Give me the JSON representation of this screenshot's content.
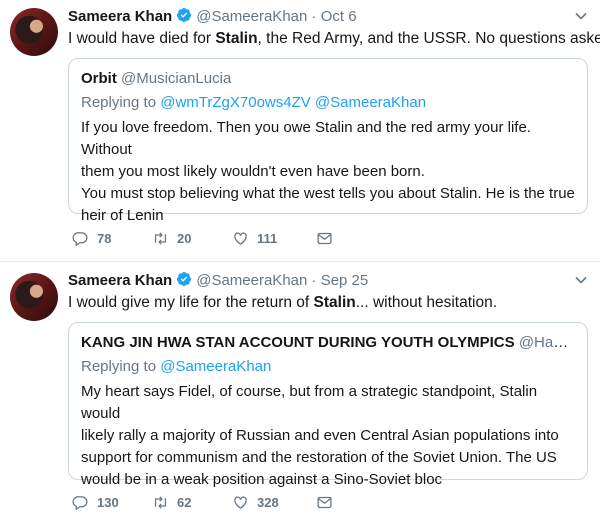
{
  "tweets": [
    {
      "author_name": "Sameera Khan",
      "author_handle": "@SameeraKhan",
      "separator": "·",
      "date": "Oct 6",
      "text_parts": [
        "I would have died for ",
        "Stalin",
        ", the Red Army, and the USSR. No questions asked."
      ],
      "quote": {
        "name": "Orbit",
        "handle": "@MusicianLucia",
        "replying_label": "Replying to",
        "replying_to": "@wmTrZgX70ows4ZV @SameeraKhan",
        "lines": [
          "If you love freedom. Then you owe Stalin and the red army your life. Without",
          "them you most likely wouldn't even have been born.",
          "You must stop believing what the west tells you about Stalin. He is the true",
          "heir of Lenin"
        ]
      },
      "replies": "78",
      "retweets": "20",
      "likes": "111"
    },
    {
      "author_name": "Sameera Khan",
      "author_handle": "@SameeraKhan",
      "separator": "·",
      "date": "Sep 25",
      "text_parts": [
        "I would give my life for the return of ",
        "Stalin",
        "... without hesitation."
      ],
      "quote": {
        "name": "KANG JIN HWA STAN ACCOUNT DURING YOUTH OLYMPICS",
        "handle": "@Hamsi...",
        "replying_label": "Replying to",
        "replying_to": "@SameeraKhan",
        "lines": [
          "My heart says Fidel, of course, but from a strategic standpoint, Stalin would",
          "likely rally a majority of Russian and even Central Asian populations into",
          "support for communism and the restoration of the Soviet Union. The US",
          "would be in a weak position against a Sino-Soviet bloc"
        ]
      },
      "replies": "130",
      "retweets": "62",
      "likes": "328"
    }
  ],
  "colors": {
    "verified": "#1da1f2",
    "link": "#1da1f2",
    "muted": "#657786",
    "border": "#ccd6dd"
  },
  "icons": [
    "verified-badge-icon",
    "chevron-down-icon",
    "reply-icon",
    "retweet-icon",
    "like-icon",
    "message-icon"
  ]
}
